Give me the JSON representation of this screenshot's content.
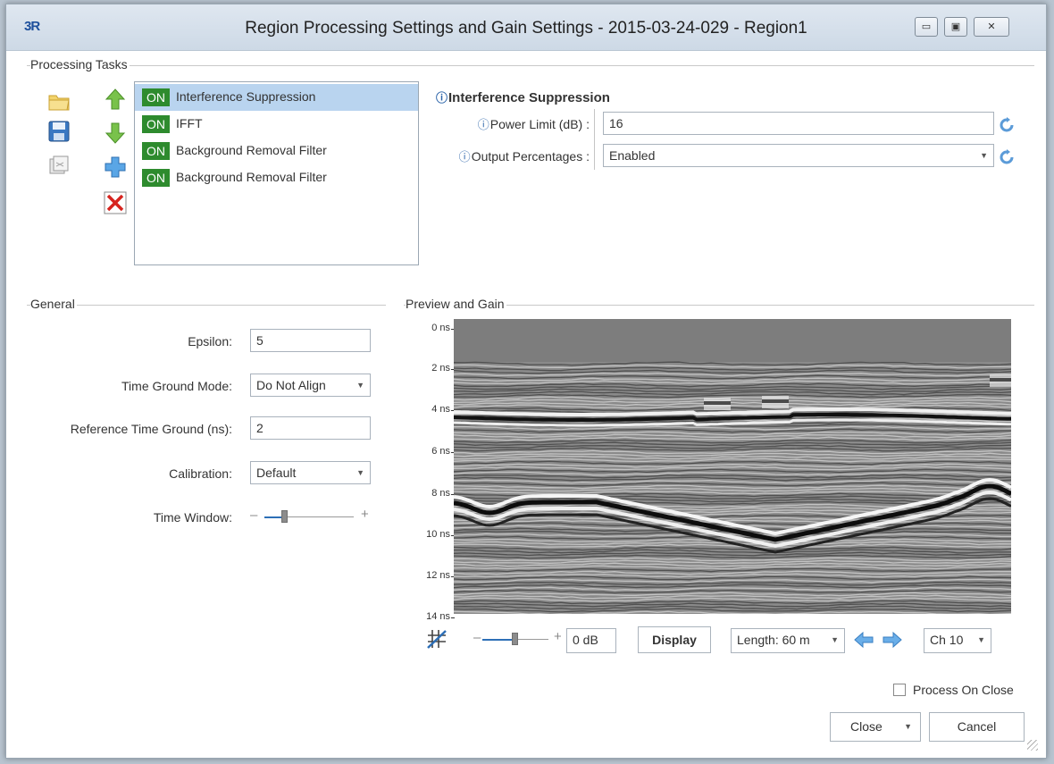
{
  "window": {
    "app_logo": "3R",
    "title": "Region Processing Settings and Gain Settings - 2015-03-24-029 - Region1",
    "minimize_glyph": "▭",
    "maximize_glyph": "▣",
    "close_glyph": "✕"
  },
  "processing": {
    "group_title": "Processing Tasks",
    "tasks": [
      {
        "state": "ON",
        "label": "Interference Suppression",
        "selected": true
      },
      {
        "state": "ON",
        "label": "IFFT",
        "selected": false
      },
      {
        "state": "ON",
        "label": "Background Removal Filter",
        "selected": false
      },
      {
        "state": "ON",
        "label": "Background Removal Filter",
        "selected": false
      }
    ],
    "toolbar_icons": [
      "open-folder-icon",
      "save-icon",
      "copy-icon",
      "move-up-icon",
      "move-down-icon",
      "add-icon",
      "delete-icon"
    ]
  },
  "properties": {
    "heading": "Interference Suppression",
    "info_glyph": "ⓘ",
    "power_limit_label": "Power Limit (dB) :",
    "power_limit_value": "16",
    "output_percentages_label": "Output Percentages :",
    "output_percentages_value": "Enabled"
  },
  "general": {
    "group_title": "General",
    "epsilon_label": "Epsilon:",
    "epsilon_value": "5",
    "time_ground_mode_label": "Time Ground Mode:",
    "time_ground_mode_value": "Do Not Align",
    "reference_time_ground_label": "Reference Time Ground (ns):",
    "reference_time_ground_value": "2",
    "calibration_label": "Calibration:",
    "calibration_value": "Default",
    "time_window_label": "Time Window:",
    "time_window_level": 0.3
  },
  "preview": {
    "group_title": "Preview and Gain",
    "time_ticks": [
      "0 ns",
      "2 ns",
      "4 ns",
      "6 ns",
      "8 ns",
      "10 ns",
      "12 ns",
      "14 ns"
    ],
    "gain_value": "0 dB",
    "gain_level": 0.55,
    "display_label": "Display",
    "length_value": "Length: 60 m",
    "channel_value": "Ch 10"
  },
  "footer": {
    "process_on_close_label": "Process On Close",
    "process_on_close_checked": false,
    "close_label": "Close",
    "cancel_label": "Cancel"
  },
  "colors": {
    "on_badge": "#2e8b2e",
    "selection": "#b9d4ef",
    "accent": "#2d6fb7"
  }
}
